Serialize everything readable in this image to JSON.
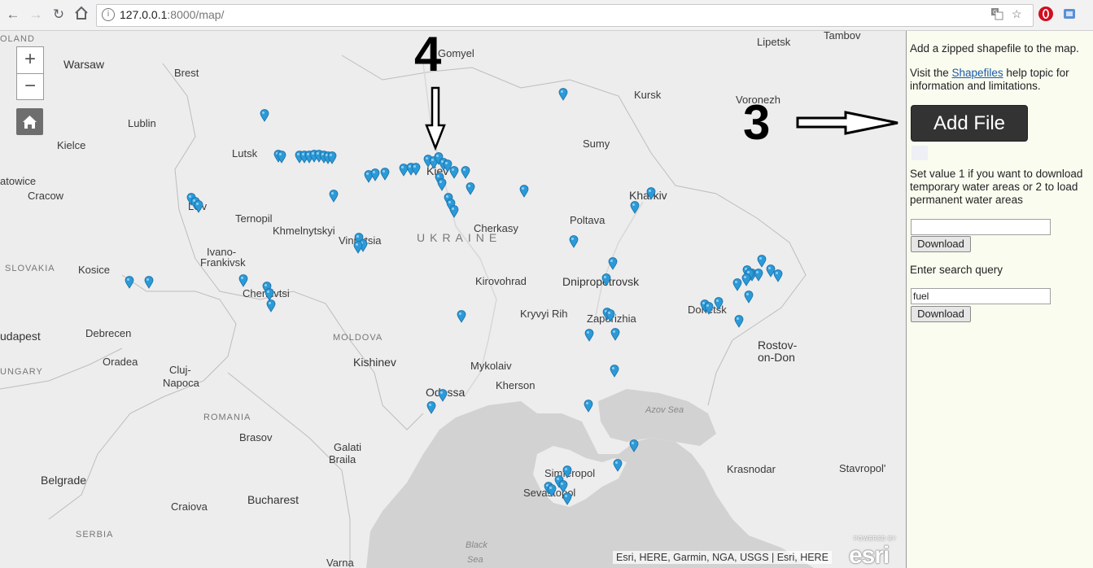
{
  "browser": {
    "url_host": "127.0.0.1",
    "url_rest": ":8000/map/",
    "back_icon": "back-arrow-icon",
    "forward_icon": "forward-arrow-icon",
    "reload_icon": "reload-icon",
    "home_icon": "home-icon"
  },
  "map": {
    "zoom_in": "+",
    "zoom_out": "−",
    "labels": {
      "oland": "OLAND",
      "warsaw": "Warsaw",
      "brest": "Brest",
      "gomyel": "Gomyel",
      "lipetsk": "Lipetsk",
      "tambov": "Tambov",
      "lublin": "Lublin",
      "kursk": "Kursk",
      "voronezh": "Voronezh",
      "kielce": "Kielce",
      "lutsk": "Lutsk",
      "sumy": "Sumy",
      "katowice": "atowice",
      "cracow": "Cracow",
      "kiev": "Kiev",
      "kharkiv": "Kharkiv",
      "lviv": "Lviv",
      "ternopil": "Ternopil",
      "khmelnytskyi": "Khmelnytskyi",
      "vinnytsia": "Vinnytsia",
      "ukraine": "UKRAINE",
      "cherkasy": "Cherkasy",
      "poltava": "Poltava",
      "ivano": "Ivano-",
      "frankivsk": "Frankivsk",
      "slovakia": "SLOVAKIA",
      "kosice": "Kosice",
      "kirovohrad": "Kirovohrad",
      "dnipropetrovsk": "Dnipropetrovsk",
      "chernivtsi": "Chernivtsi",
      "kryvyi_rih": "Kryvyi Rih",
      "zaporizhia": "Zaporizhia",
      "donetsk": "Donetsk",
      "budapest": "udapest",
      "debrecen": "Debrecen",
      "moldova": "MOLDOVA",
      "rostov_1": "Rostov-",
      "rostov_2": "on-Don",
      "oradea": "Oradea",
      "cluj": "Cluj-",
      "napoca": "Napoca",
      "kishinev": "Kishinev",
      "mykolaiv": "Mykolaiv",
      "ungary": "UNGARY",
      "kherson": "Kherson",
      "odessa": "Odessa",
      "azov_sea": "Azov Sea",
      "romania": "ROMANIA",
      "brasov": "Brasov",
      "galati": "Galati",
      "braila": "Braila",
      "simferopol": "Simferopol",
      "krasnodar": "Krasnodar",
      "stavropol": "Stavropol'",
      "belgrade": "Belgrade",
      "sevastopol": "Sevastopol",
      "craiova": "Craiova",
      "bucharest": "Bucharest",
      "serbia": "SERBIA",
      "black": "Black",
      "sea": "Sea",
      "varna": "Varna"
    },
    "attribution": "Esri, HERE, Garmin, NGA, USGS | Esri, HERE",
    "esri_powered": "POWERED BY",
    "esri_logo": "esri",
    "marker_color": "#2b9ad8"
  },
  "annotations": {
    "number_4": "4",
    "number_3": "3"
  },
  "panel": {
    "intro": "Add a zipped shapefile to the map.",
    "help_prefix": "Visit the ",
    "help_link": "Shapefiles",
    "help_suffix": " help topic for information and limitations.",
    "add_file": "Add File",
    "value_instructions": "Set value 1 if you want to download temporary water areas or 2 to load permanent water areas",
    "value_input": "",
    "download_1": "Download",
    "search_label": "Enter search query",
    "search_input": "fuel",
    "download_2": "Download"
  }
}
